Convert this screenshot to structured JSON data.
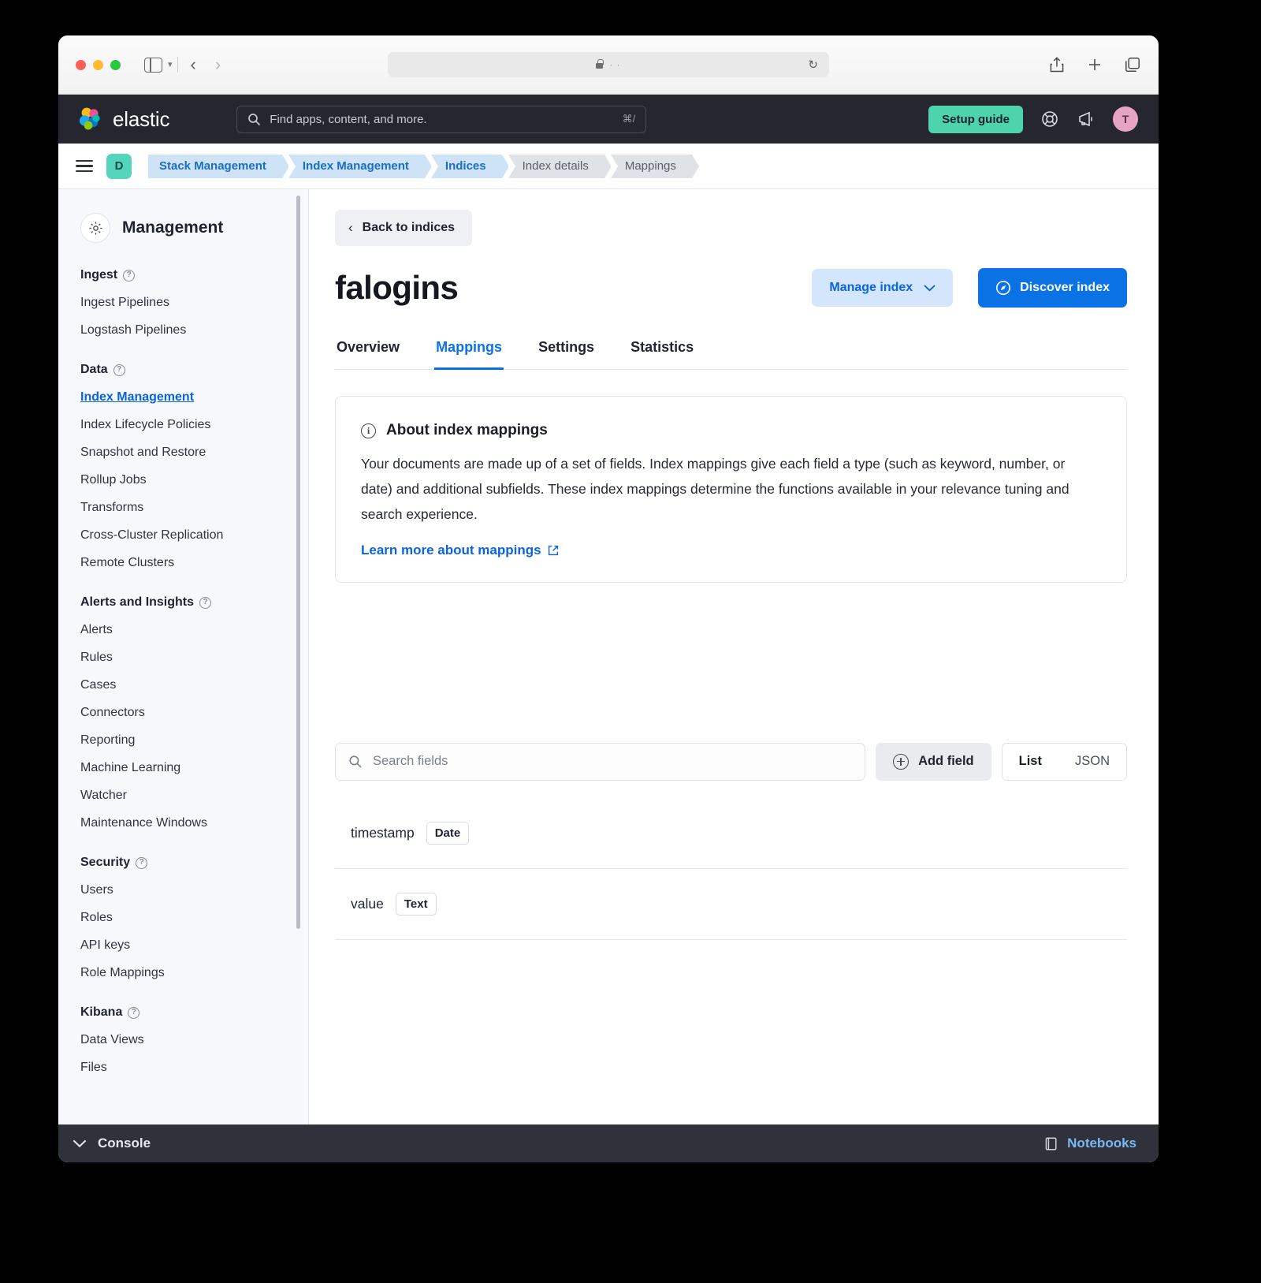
{
  "browser": {
    "url_text": "· ·",
    "icons": {
      "sidebar": "sidebar-toggle-icon",
      "back": "back-arrow-icon",
      "forward": "forward-arrow-icon",
      "lock": "lock-icon",
      "reload": "reload-icon",
      "share": "share-icon",
      "new_tab": "plus-icon",
      "tabs": "tabs-overview-icon"
    }
  },
  "header": {
    "brand": "elastic",
    "search_placeholder": "Find apps, content, and more.",
    "search_shortcut": "⌘/",
    "setup_guide": "Setup guide",
    "help_icon": "help-buoy-icon",
    "announcements_icon": "megaphone-icon",
    "avatar_initial": "T"
  },
  "breadcrumbs": {
    "space_initial": "D",
    "items": [
      {
        "label": "Stack Management",
        "active": true
      },
      {
        "label": "Index Management",
        "active": true
      },
      {
        "label": "Indices",
        "active": true
      },
      {
        "label": "Index details",
        "active": false
      },
      {
        "label": "Mappings",
        "active": false
      }
    ]
  },
  "sidebar": {
    "title": "Management",
    "groups": [
      {
        "label": "Ingest",
        "items": [
          {
            "label": "Ingest Pipelines",
            "active": false
          },
          {
            "label": "Logstash Pipelines",
            "active": false
          }
        ]
      },
      {
        "label": "Data",
        "items": [
          {
            "label": "Index Management",
            "active": true
          },
          {
            "label": "Index Lifecycle Policies",
            "active": false
          },
          {
            "label": "Snapshot and Restore",
            "active": false
          },
          {
            "label": "Rollup Jobs",
            "active": false
          },
          {
            "label": "Transforms",
            "active": false
          },
          {
            "label": "Cross-Cluster Replication",
            "active": false
          },
          {
            "label": "Remote Clusters",
            "active": false
          }
        ]
      },
      {
        "label": "Alerts and Insights",
        "items": [
          {
            "label": "Alerts",
            "active": false
          },
          {
            "label": "Rules",
            "active": false
          },
          {
            "label": "Cases",
            "active": false
          },
          {
            "label": "Connectors",
            "active": false
          },
          {
            "label": "Reporting",
            "active": false
          },
          {
            "label": "Machine Learning",
            "active": false
          },
          {
            "label": "Watcher",
            "active": false
          },
          {
            "label": "Maintenance Windows",
            "active": false
          }
        ]
      },
      {
        "label": "Security",
        "items": [
          {
            "label": "Users",
            "active": false
          },
          {
            "label": "Roles",
            "active": false
          },
          {
            "label": "API keys",
            "active": false
          },
          {
            "label": "Role Mappings",
            "active": false
          }
        ]
      },
      {
        "label": "Kibana",
        "items": [
          {
            "label": "Data Views",
            "active": false
          },
          {
            "label": "Files",
            "active": false
          }
        ]
      }
    ]
  },
  "main": {
    "back_button": "Back to indices",
    "index_name": "falogins",
    "manage_index": "Manage index",
    "discover_index": "Discover index",
    "tabs": [
      {
        "label": "Overview",
        "selected": false
      },
      {
        "label": "Mappings",
        "selected": true
      },
      {
        "label": "Settings",
        "selected": false
      },
      {
        "label": "Statistics",
        "selected": false
      }
    ],
    "info_panel": {
      "title": "About index mappings",
      "body": "Your documents are made up of a set of fields. Index mappings give each field a type (such as keyword, number, or date) and additional subfields. These index mappings determine the functions available in your relevance tuning and search experience.",
      "link": "Learn more about mappings"
    },
    "toolbar": {
      "search_placeholder": "Search fields",
      "search_value": "",
      "add_field": "Add field",
      "view_modes": [
        {
          "label": "List",
          "selected": true
        },
        {
          "label": "JSON",
          "selected": false
        }
      ]
    },
    "fields": [
      {
        "name": "timestamp",
        "type": "Date"
      },
      {
        "name": "value",
        "type": "Text"
      }
    ]
  },
  "console": {
    "label": "Console",
    "notebooks": "Notebooks"
  },
  "colors": {
    "accent_blue": "#0b72e6",
    "link_blue": "#0b64dd",
    "teal": "#4dd4ac",
    "dark_header": "#25262e",
    "console_bar": "#2f313b"
  }
}
